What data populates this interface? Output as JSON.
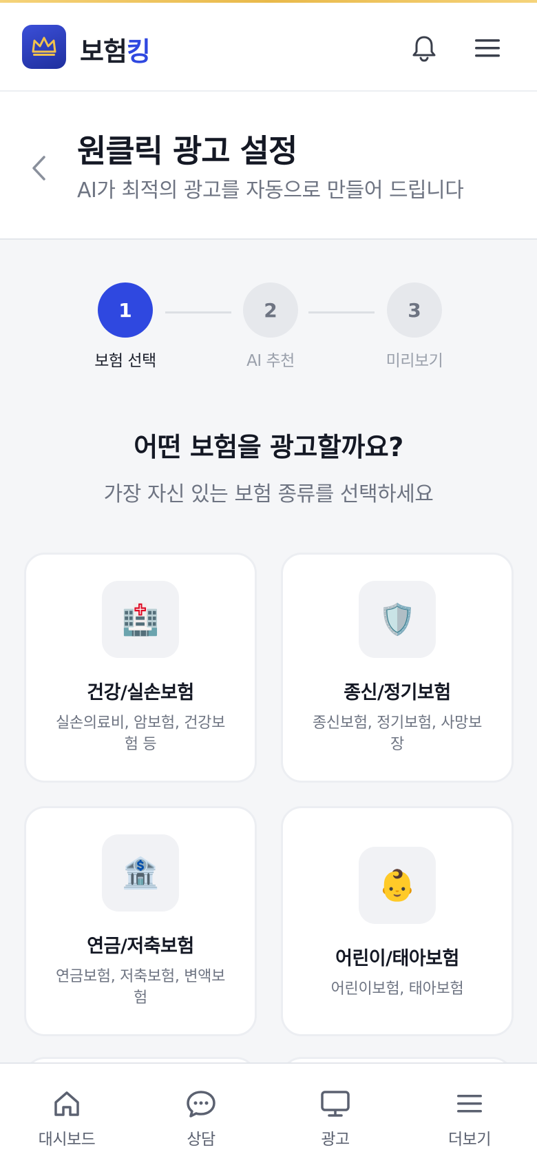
{
  "header": {
    "app_name_part1": "보험",
    "app_name_part2": "킹",
    "icons": [
      "crown-icon",
      "bell-icon",
      "hamburger-menu-icon"
    ]
  },
  "page": {
    "title": "원클릭 광고 설정",
    "subtitle": "AI가 최적의 광고를 자동으로 만들어 드립니다"
  },
  "stepper": {
    "current_step": 1,
    "steps": [
      {
        "number": "1",
        "label": "보험 선택"
      },
      {
        "number": "2",
        "label": "AI 추천"
      },
      {
        "number": "3",
        "label": "미리보기"
      }
    ]
  },
  "question": {
    "title": "어떤 보험을 광고할까요?",
    "subtitle": "가장 자신 있는 보험 종류를 선택하세요"
  },
  "categories": [
    {
      "icon": "🏥",
      "icon_name": "hospital-icon",
      "title": "건강/실손보험",
      "desc": "실손의료비, 암보험, 건강보험 등"
    },
    {
      "icon": "🛡️",
      "icon_name": "shield-icon",
      "title": "종신/정기보험",
      "desc": "종신보험, 정기보험, 사망보장"
    },
    {
      "icon": "🏦",
      "icon_name": "bank-icon",
      "title": "연금/저축보험",
      "desc": "연금보험, 저축보험, 변액보험"
    },
    {
      "icon": "👶",
      "icon_name": "baby-icon",
      "title": "어린이/태아보험",
      "desc": "어린이보험, 태아보험"
    }
  ],
  "bottom_nav": [
    {
      "label": "대시보드",
      "icon": "home-icon"
    },
    {
      "label": "상담",
      "icon": "chat-bubble-icon"
    },
    {
      "label": "광고",
      "icon": "monitor-icon"
    },
    {
      "label": "더보기",
      "icon": "hamburger-menu-icon"
    }
  ],
  "colors": {
    "primary": "#2f48e0",
    "accent_gold": "#e9b94a",
    "text_dark": "#141824",
    "text_muted": "#6e7482"
  }
}
